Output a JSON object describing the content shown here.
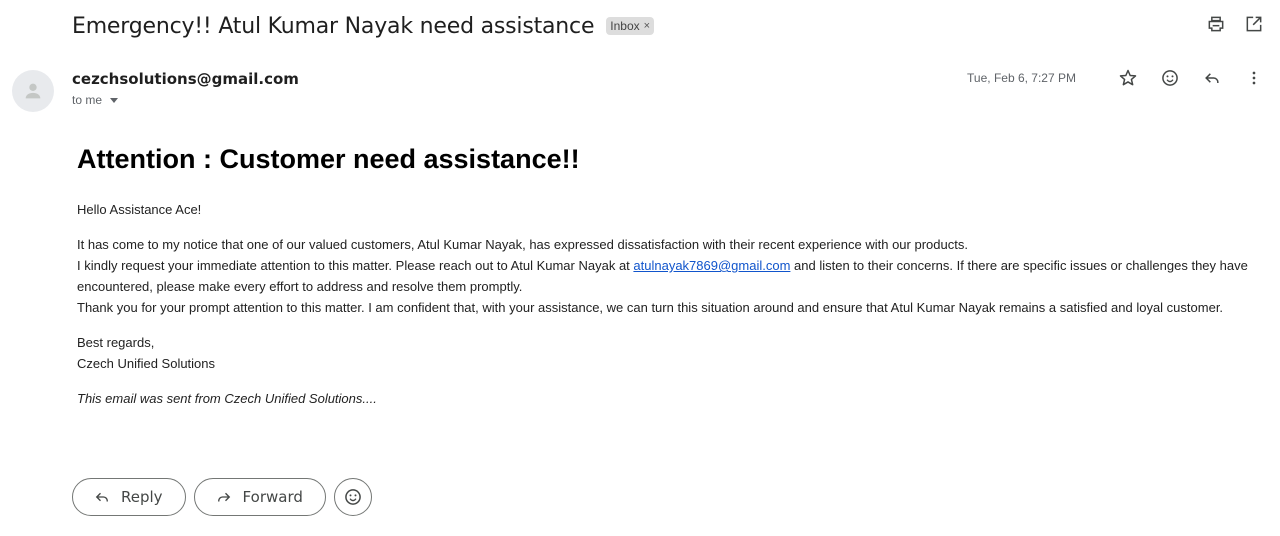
{
  "email": {
    "subject": "Emergency!! Atul Kumar Nayak need assistance",
    "label": "Inbox",
    "label_remove": "×",
    "sender": "cezchsolutions@gmail.com",
    "recipient": "to me",
    "date": "Tue, Feb 6, 7:27 PM"
  },
  "icons": {
    "print": "print-icon",
    "open_new_window": "open-in-new-window-icon",
    "avatar": "person-avatar-icon",
    "star": "star-icon",
    "emoji": "emoji-reaction-icon",
    "reply": "reply-icon",
    "more": "more-vertical-icon",
    "forward": "forward-icon"
  },
  "body": {
    "headline": "Attention : Customer need assistance!!",
    "greeting": "Hello Assistance Ace!",
    "para1_line1": "It has come to my notice that one of our valued customers, Atul Kumar Nayak, has expressed dissatisfaction with their recent experience with our products.",
    "para1_line2_before": "I kindly request your immediate attention to this matter. Please reach out to Atul Kumar Nayak at ",
    "para1_link": "atulnayak7869@gmail.com",
    "para1_line2_after": " and listen to their concerns. If there are specific issues or challenges they have encountered, please make every effort to address and resolve them promptly.",
    "para1_line3": "Thank you for your prompt attention to this matter. I am confident that, with your assistance, we can turn this situation around and ensure that Atul Kumar Nayak remains a satisfied and loyal customer.",
    "signoff": "Best regards,",
    "signature": "Czech Unified Solutions",
    "footer": "This email was sent from Czech Unified Solutions...."
  },
  "actions": {
    "reply": "Reply",
    "forward": "Forward"
  }
}
